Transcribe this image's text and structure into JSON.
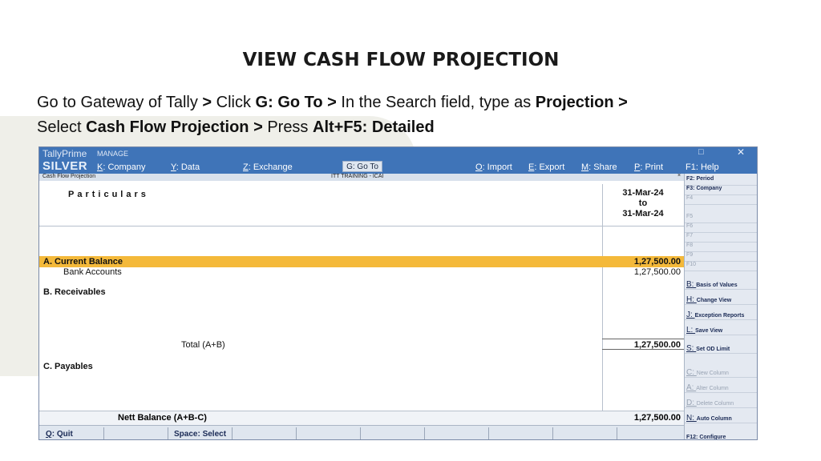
{
  "slide": {
    "title": "VIEW CASH FLOW PROJECTION",
    "line1": [
      {
        "t": "Go to Gateway of Tally ",
        "b": false
      },
      {
        "t": "> ",
        "b": true
      },
      {
        "t": "Click ",
        "b": false
      },
      {
        "t": "G: Go To > ",
        "b": true
      },
      {
        "t": "In the Search field, type as ",
        "b": false
      },
      {
        "t": "Projection >",
        "b": true
      }
    ],
    "line2": [
      {
        "t": "Select ",
        "b": false
      },
      {
        "t": "Cash Flow Projection > ",
        "b": true
      },
      {
        "t": "Press ",
        "b": false
      },
      {
        "t": "Alt+F5: Detailed",
        "b": true
      }
    ]
  },
  "tally": {
    "brand": "TallyPrime",
    "edition": "SILVER",
    "manage": "MANAGE",
    "menu": [
      {
        "key": "K",
        "label": ": Company"
      },
      {
        "key": "Y",
        "label": ": Data"
      },
      {
        "key": "Z",
        "label": ": Exchange"
      },
      {
        "key": "O",
        "label": ": Import"
      },
      {
        "key": "E",
        "label": ": Export"
      },
      {
        "key": "M",
        "label": ": Share"
      },
      {
        "key": "P",
        "label": ": Print"
      }
    ],
    "goto": "G: Go To",
    "help": "F1: Help",
    "window_min": "□",
    "window_close": "✕",
    "report_name": "Cash Flow Projection",
    "company": "ITT TRAINING - ICAI",
    "report_close": "×",
    "col_particulars": "Particulars",
    "col_date": [
      "31-Mar-24",
      "to",
      "31-Mar-24"
    ],
    "rows": {
      "current_balance": {
        "label": "A. Current Balance",
        "amount": "1,27,500.00"
      },
      "bank_accounts": {
        "label": "Bank Accounts",
        "amount": "1,27,500.00"
      },
      "receivables": {
        "label": "B. Receivables"
      },
      "total_ab": {
        "label": "Total (A+B)",
        "amount": "1,27,500.00"
      },
      "payables": {
        "label": "C. Payables"
      }
    },
    "nett": {
      "label": "Nett Balance (A+B-C)",
      "amount": "1,27,500.00"
    },
    "bottom": {
      "quit_key": "Q",
      "quit": ": Quit",
      "select": "Space: Select"
    },
    "sidebar": [
      {
        "key": "",
        "label": "F2: Period",
        "dim": false
      },
      {
        "key": "",
        "label": "F3: Company",
        "dim": false
      },
      {
        "key": "",
        "label": "F4",
        "dim": true
      },
      {
        "key": "",
        "label": "F5",
        "dim": true
      },
      {
        "key": "",
        "label": "F6",
        "dim": true
      },
      {
        "key": "",
        "label": "F7",
        "dim": true
      },
      {
        "key": "",
        "label": "F8",
        "dim": true
      },
      {
        "key": "",
        "label": "F9",
        "dim": true
      },
      {
        "key": "",
        "label": "F10",
        "dim": true
      },
      {
        "key": "B",
        "label": "Basis of Values",
        "dim": false
      },
      {
        "key": "H",
        "label": "Change View",
        "dim": false
      },
      {
        "key": "J",
        "label": "Exception Reports",
        "dim": false
      },
      {
        "key": "L",
        "label": "Save View",
        "dim": false
      },
      {
        "key": "S",
        "label": "Set OD Limit",
        "dim": false
      },
      {
        "key": "C",
        "label": "New Column",
        "dim": true
      },
      {
        "key": "A",
        "label": "Alter Column",
        "dim": true
      },
      {
        "key": "D",
        "label": "Delete Column",
        "dim": true
      },
      {
        "key": "N",
        "label": "Auto Column",
        "dim": false
      },
      {
        "key": "",
        "label": "F12: Configure",
        "dim": false
      }
    ]
  }
}
